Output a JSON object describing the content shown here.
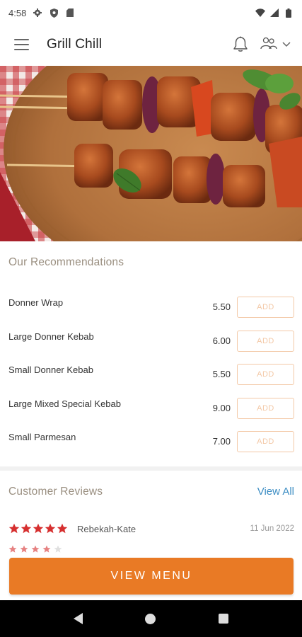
{
  "status_bar": {
    "time": "4:58",
    "icons": [
      "gear-icon",
      "shield-icon",
      "sd-card-icon",
      "wifi-icon",
      "signal-icon",
      "battery-icon"
    ]
  },
  "app_bar": {
    "title": "Grill Chill",
    "icons": [
      "menu-icon",
      "bell-icon",
      "people-icon",
      "chevron-down-icon"
    ]
  },
  "hero": {
    "image": "grilled-kebab-skewers-photo"
  },
  "recommendations": {
    "title": "Our Recommendations",
    "add_label": "ADD",
    "items": [
      {
        "name": "Donner Wrap",
        "price": "5.50"
      },
      {
        "name": "Large Donner Kebab",
        "price": "6.00"
      },
      {
        "name": "Small Donner Kebab",
        "price": "5.50"
      },
      {
        "name": "Large Mixed Special Kebab",
        "price": "9.00"
      },
      {
        "name": "Small Parmesan",
        "price": "7.00"
      }
    ]
  },
  "reviews": {
    "title": "Customer Reviews",
    "view_all": "View All",
    "items": [
      {
        "author": "Rebekah-Kate",
        "date": "11 Jun 2022",
        "rating": 5
      }
    ]
  },
  "cta": {
    "label": "VIEW MENU"
  },
  "colors": {
    "accent": "#e97a25",
    "add_border": "#f3c8a6",
    "link": "#3d8ec4",
    "star": "#d62f2f",
    "section_title": "#9a8f80"
  }
}
